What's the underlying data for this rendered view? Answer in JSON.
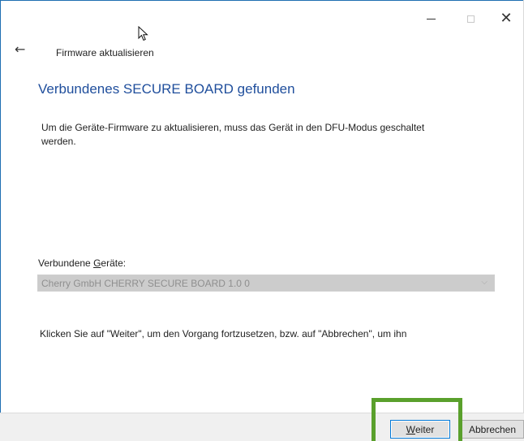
{
  "window": {
    "title": "Firmware aktualisieren",
    "controls": {
      "minimize_glyph": "–",
      "maximize_glyph": "☐",
      "close_glyph": "✕"
    }
  },
  "header": {
    "back_glyph": "←",
    "heading": "Verbundenes SECURE BOARD gefunden"
  },
  "main": {
    "description": "Um die Geräte-Firmware zu aktualisieren, muss das Gerät in den DFU-Modus geschaltet werden.",
    "devices_label_before": "Verbundene ",
    "devices_label_mnemonic": "G",
    "devices_label_after": "eräte:",
    "device_selected": "Cherry GmbH CHERRY SECURE BOARD 1.0 0",
    "device_chevron_glyph": "⌵",
    "instruction": "Klicken Sie auf \"Weiter\", um den Vorgang fortzusetzen, bzw. auf \"Abbrechen\", um ihn"
  },
  "footer": {
    "next_mnemonic": "W",
    "next_rest": "eiter",
    "cancel_label": "Abbrechen"
  },
  "icons": {
    "back": "back-arrow-icon",
    "cursor": "mouse-pointer-icon",
    "dropdown": "chevron-down-icon"
  },
  "colors": {
    "heading": "#1f4e9c",
    "highlight": "#5aa02c",
    "default_button_border": "#0078d7",
    "footer_bg": "#f0f0f0",
    "disabled_select_bg": "#cccccc"
  }
}
